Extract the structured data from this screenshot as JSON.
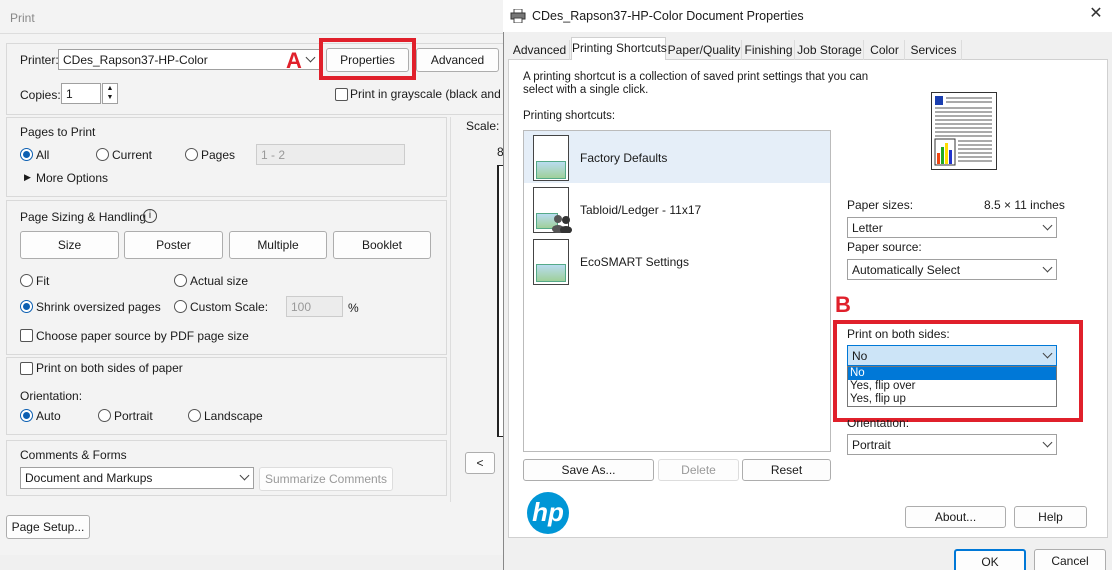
{
  "print_dialog": {
    "title": "Print",
    "printer_label": "Printer:",
    "printer_value": "CDes_Rapson37-HP-Color",
    "properties_button": "Properties",
    "advanced_button": "Advanced",
    "copies_label": "Copies:",
    "copies_value": "1",
    "grayscale_label": "Print in grayscale (black and wh",
    "pages_to_print": {
      "heading": "Pages to Print",
      "all": "All",
      "current": "Current",
      "pages": "Pages",
      "pages_placeholder": "1 - 2",
      "more_options": "More Options"
    },
    "page_sizing": {
      "heading": "Page Sizing & Handling",
      "size_button": "Size",
      "poster_button": "Poster",
      "multiple_button": "Multiple",
      "booklet_button": "Booklet",
      "fit": "Fit",
      "actual_size": "Actual size",
      "shrink": "Shrink oversized pages",
      "custom_scale": "Custom Scale:",
      "custom_scale_value": "100",
      "percent": "%",
      "choose_source": "Choose paper source by PDF page size"
    },
    "both_sides_label": "Print on both sides of paper",
    "orientation": {
      "heading": "Orientation:",
      "auto": "Auto",
      "portrait": "Portrait",
      "landscape": "Landscape"
    },
    "comments": {
      "heading": "Comments & Forms",
      "value": "Document and Markups",
      "summarize_button": "Summarize Comments"
    },
    "scale_label": "Scale:",
    "preview_fragment": "8",
    "nav_prev": "<",
    "page_setup_button": "Page Setup..."
  },
  "props_dialog": {
    "title": "CDes_Rapson37-HP-Color Document Properties",
    "tabs": [
      "Advanced",
      "Printing Shortcuts",
      "Paper/Quality",
      "Finishing",
      "Job Storage",
      "Color",
      "Services"
    ],
    "description": "A printing shortcut is a collection of saved print settings that you can select with a single click.",
    "shortcuts_label": "Printing shortcuts:",
    "shortcuts": [
      "Factory Defaults",
      "Tabloid/Ledger - 11x17",
      "EcoSMART Settings"
    ],
    "paper_sizes_label": "Paper sizes:",
    "paper_sizes_dim": "8.5 × 11 inches",
    "paper_size_value": "Letter",
    "paper_source_label": "Paper source:",
    "paper_source_value": "Automatically Select",
    "both_sides_label": "Print on both sides:",
    "both_sides_value": "No",
    "both_sides_options": [
      "No",
      "Yes, flip over",
      "Yes, flip up"
    ],
    "orientation_label": "Orientation:",
    "orientation_value": "Portrait",
    "save_as_button": "Save As...",
    "delete_button": "Delete",
    "reset_button": "Reset",
    "about_button": "About...",
    "help_button": "Help",
    "ok_button": "OK",
    "cancel_button": "Cancel",
    "hp_logo": "hp"
  },
  "annotations": {
    "a": "A",
    "b": "B"
  },
  "colors": {
    "accent": "#0c5fb2",
    "highlight": "#e0202b",
    "selection": "#cce4f7",
    "hp_blue": "#0096d6"
  }
}
